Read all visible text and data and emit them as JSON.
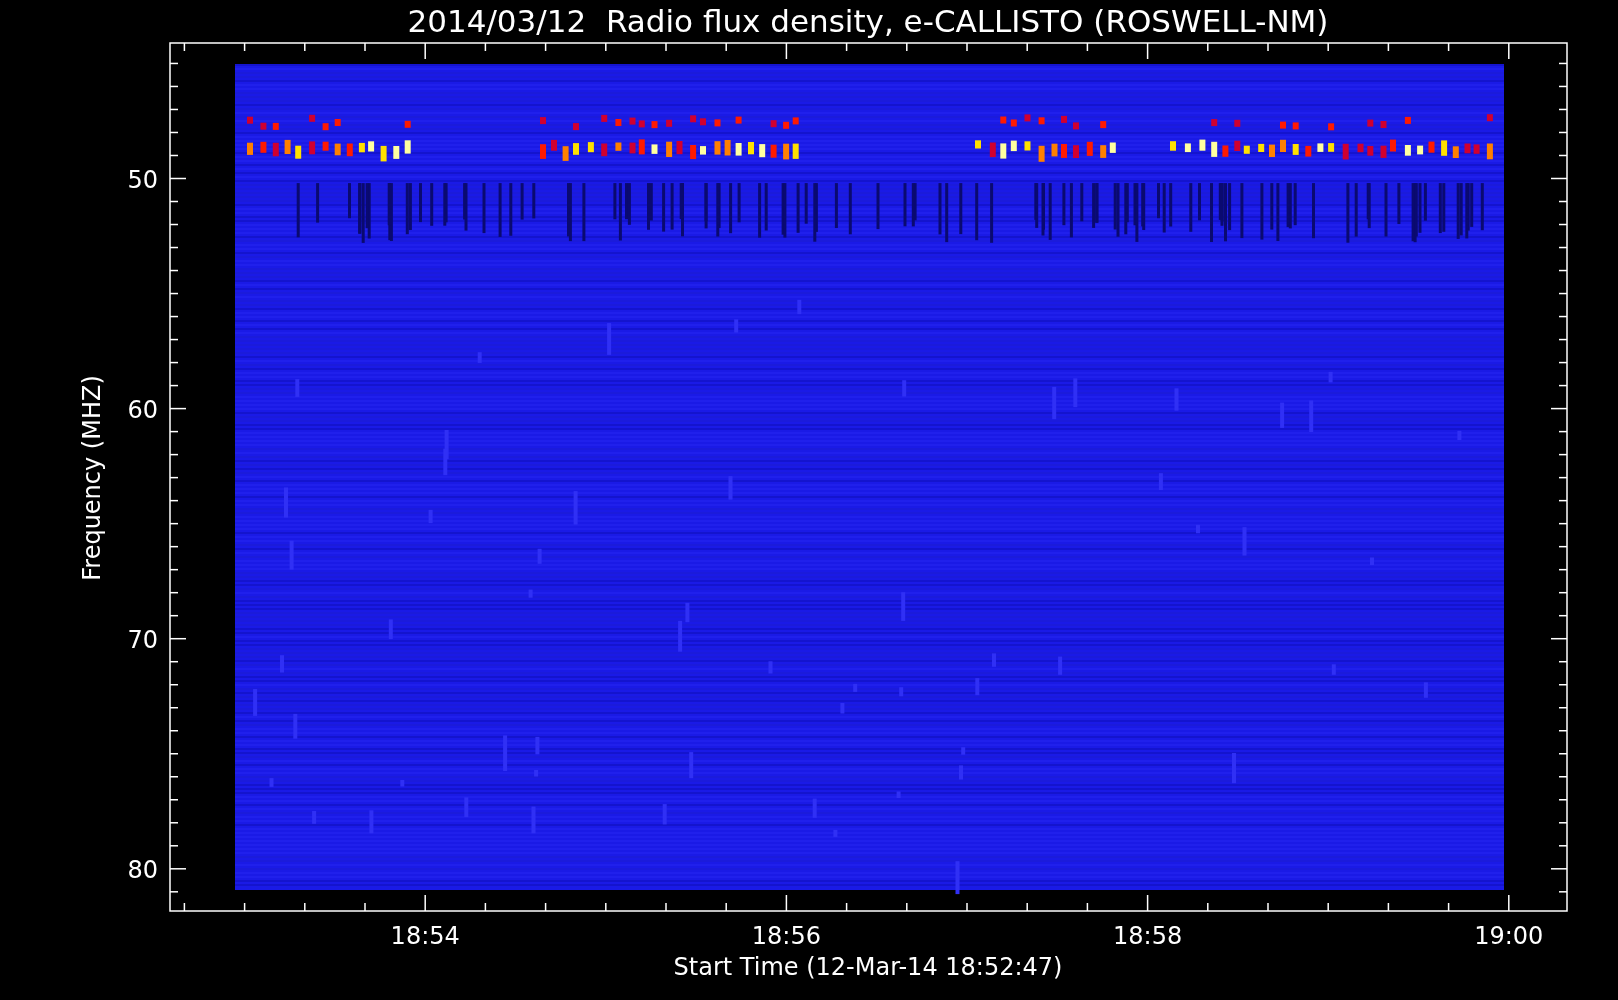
{
  "title": "2014/03/12  Radio flux density, e-CALLISTO (ROSWELL-NM)",
  "y_axis": {
    "label": "Frequency (MHZ)",
    "ticks": [
      "50",
      "60",
      "70",
      "80"
    ]
  },
  "x_axis": {
    "label": "Start Time (12-Mar-14 18:52:47)",
    "ticks": [
      "18:54",
      "18:56",
      "18:58",
      "19:00"
    ]
  }
}
